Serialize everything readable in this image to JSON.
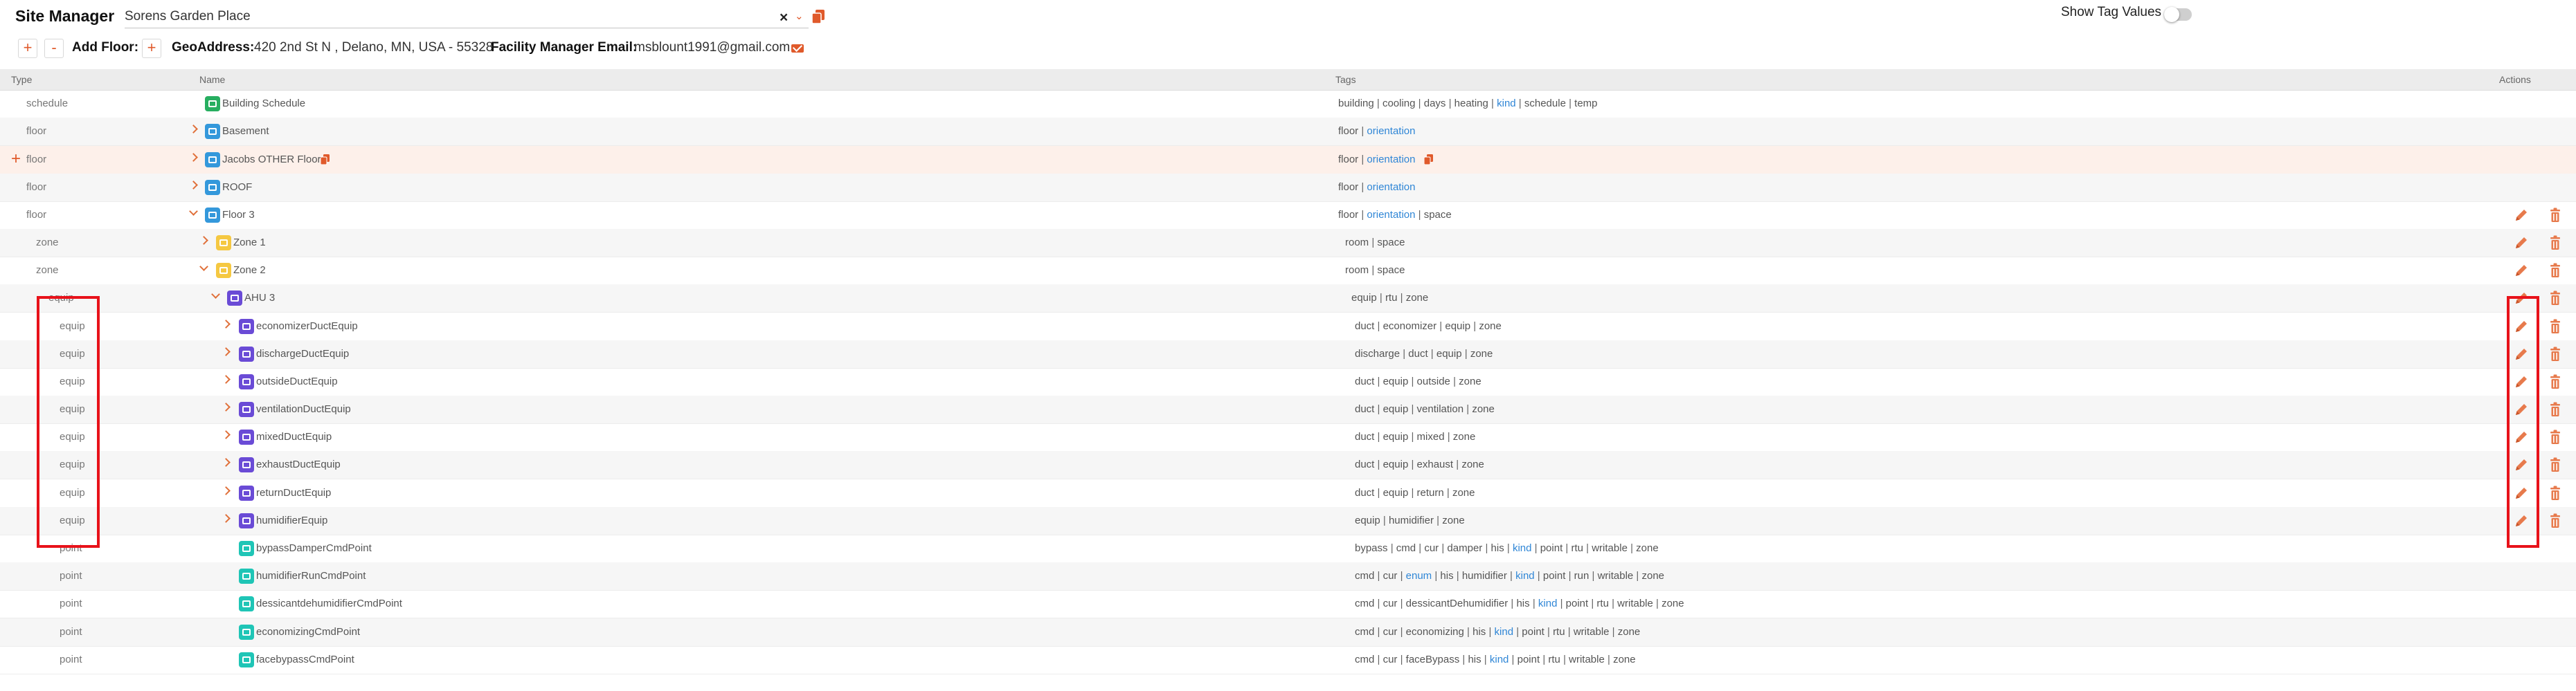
{
  "header": {
    "title": "Site Manager",
    "site_value": "Sorens Garden Place",
    "clear_glyph": "×",
    "chevron_glyph": "⌄",
    "show_tag_values_label": "Show Tag Values",
    "add_floor_label": "Add Floor:",
    "geo_label": "GeoAddress:",
    "geo_value": "420 2nd St N , Delano, MN, USA - 55328",
    "fm_email_label": "Facility Manager Email:",
    "fm_email_value": "msblount1991@gmail.com",
    "plus_glyph": "+",
    "minus_glyph": "-"
  },
  "table": {
    "columns": {
      "type": "Type",
      "name": "Name",
      "tags": "Tags",
      "actions": "Actions"
    },
    "rows": [
      {
        "type": "schedule",
        "name": "Building Schedule",
        "icon": "schedule",
        "tags": [
          "building",
          "cooling",
          "days",
          "heating",
          "kind",
          "schedule",
          "temp"
        ],
        "links": [
          "kind"
        ]
      },
      {
        "type": "floor",
        "name": "Basement",
        "icon": "floor",
        "tags": [
          "floor",
          "orientation"
        ],
        "links": [
          "orientation"
        ]
      },
      {
        "type": "floor",
        "name": "Jacobs OTHER Floor",
        "icon": "floor",
        "tags": [
          "floor",
          "orientation"
        ],
        "links": [
          "orientation"
        ]
      },
      {
        "type": "floor",
        "name": "ROOF",
        "icon": "floor",
        "tags": [
          "floor",
          "orientation"
        ],
        "links": [
          "orientation"
        ]
      },
      {
        "type": "floor",
        "name": "Floor 3",
        "icon": "floor",
        "tags": [
          "floor",
          "orientation",
          "space"
        ],
        "links": [
          "orientation"
        ]
      },
      {
        "type": "zone",
        "name": "Zone 1",
        "icon": "zone",
        "tags": [
          "room",
          "space"
        ],
        "links": []
      },
      {
        "type": "zone",
        "name": "Zone 2",
        "icon": "zone",
        "tags": [
          "room",
          "space"
        ],
        "links": []
      },
      {
        "type": "equip",
        "name": "AHU 3",
        "icon": "equip",
        "tags": [
          "equip",
          "rtu",
          "zone"
        ],
        "links": []
      },
      {
        "type": "equip",
        "name": "economizerDuctEquip",
        "icon": "equip",
        "tags": [
          "duct",
          "economizer",
          "equip",
          "zone"
        ],
        "links": []
      },
      {
        "type": "equip",
        "name": "dischargeDuctEquip",
        "icon": "equip",
        "tags": [
          "discharge",
          "duct",
          "equip",
          "zone"
        ],
        "links": []
      },
      {
        "type": "equip",
        "name": "outsideDuctEquip",
        "icon": "equip",
        "tags": [
          "duct",
          "equip",
          "outside",
          "zone"
        ],
        "links": []
      },
      {
        "type": "equip",
        "name": "ventilationDuctEquip",
        "icon": "equip",
        "tags": [
          "duct",
          "equip",
          "ventilation",
          "zone"
        ],
        "links": []
      },
      {
        "type": "equip",
        "name": "mixedDuctEquip",
        "icon": "equip",
        "tags": [
          "duct",
          "equip",
          "mixed",
          "zone"
        ],
        "links": []
      },
      {
        "type": "equip",
        "name": "exhaustDuctEquip",
        "icon": "equip",
        "tags": [
          "duct",
          "equip",
          "exhaust",
          "zone"
        ],
        "links": []
      },
      {
        "type": "equip",
        "name": "returnDuctEquip",
        "icon": "equip",
        "tags": [
          "duct",
          "equip",
          "return",
          "zone"
        ],
        "links": []
      },
      {
        "type": "equip",
        "name": "humidifierEquip",
        "icon": "equip",
        "tags": [
          "equip",
          "humidifier",
          "zone"
        ],
        "links": []
      },
      {
        "type": "point",
        "name": "bypassDamperCmdPoint",
        "icon": "point",
        "tags": [
          "bypass",
          "cmd",
          "cur",
          "damper",
          "his",
          "kind",
          "point",
          "rtu",
          "writable",
          "zone"
        ],
        "links": [
          "kind"
        ]
      },
      {
        "type": "point",
        "name": "humidifierRunCmdPoint",
        "icon": "point",
        "tags": [
          "cmd",
          "cur",
          "enum",
          "his",
          "humidifier",
          "kind",
          "point",
          "run",
          "writable",
          "zone"
        ],
        "links": [
          "enum",
          "kind"
        ]
      },
      {
        "type": "point",
        "name": "dessicantdehumidifierCmdPoint",
        "icon": "point",
        "tags": [
          "cmd",
          "cur",
          "dessicantDehumidifier",
          "his",
          "kind",
          "point",
          "rtu",
          "writable",
          "zone"
        ],
        "links": [
          "kind"
        ]
      },
      {
        "type": "point",
        "name": "economizingCmdPoint",
        "icon": "point",
        "tags": [
          "cmd",
          "cur",
          "economizing",
          "his",
          "kind",
          "point",
          "rtu",
          "writable",
          "zone"
        ],
        "links": [
          "kind"
        ]
      },
      {
        "type": "point",
        "name": "facebypassCmdPoint",
        "icon": "point",
        "tags": [
          "cmd",
          "cur",
          "faceBypass",
          "his",
          "kind",
          "point",
          "rtu",
          "writable",
          "zone"
        ],
        "links": [
          "kind"
        ]
      }
    ]
  },
  "colors": {
    "accent": "#e05a2b",
    "link": "#2f86d6",
    "highlight_box": "#e8121a"
  }
}
